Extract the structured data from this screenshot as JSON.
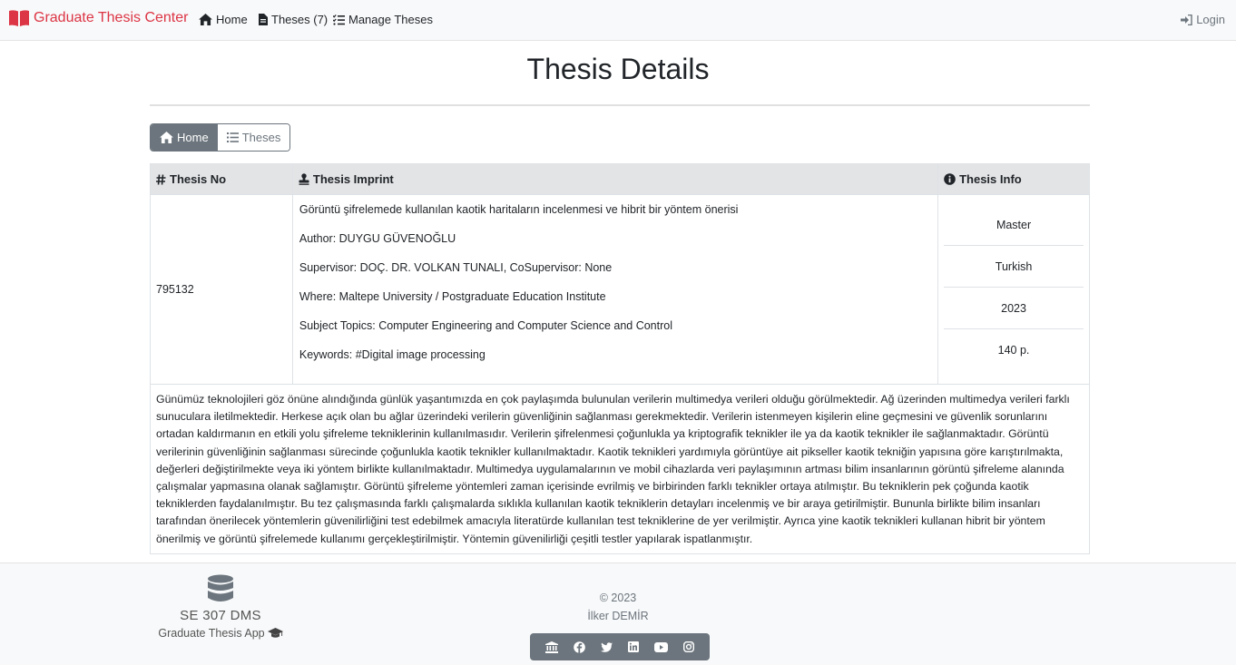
{
  "nav": {
    "brand": "Graduate Thesis Center",
    "home": "Home",
    "theses": "Theses (7)",
    "manage": "Manage Theses",
    "login": "Login"
  },
  "page_title": "Thesis Details",
  "buttons": {
    "home": "Home",
    "theses": "Theses"
  },
  "table": {
    "headers": {
      "no": "Thesis No",
      "imprint": "Thesis Imprint",
      "info": "Thesis Info"
    },
    "thesis_no": "795132",
    "imprint": {
      "title": "Görüntü şifrelemede kullanılan kaotik haritaların incelenmesi ve hibrit bir yöntem önerisi",
      "author": "Author: DUYGU GÜVENOĞLU",
      "supervisor": "Supervisor: DOÇ. DR. VOLKAN TUNALI, CoSupervisor: None",
      "where": "Where: Maltepe University / Postgraduate Education Institute",
      "subjects": "Subject Topics: Computer Engineering and Computer Science and Control",
      "keywords": "Keywords: #Digital image processing"
    },
    "info": {
      "type": "Master",
      "language": "Turkish",
      "year": "2023",
      "pages": "140 p."
    },
    "abstract": "Günümüz teknolojileri göz önüne alındığında günlük yaşantımızda en çok paylaşımda bulunulan verilerin multimedya verileri olduğu görülmektedir. Ağ üzerinden multimedya verileri farklı sunuculara iletilmektedir. Herkese açık olan bu ağlar üzerindeki verilerin güvenliğinin sağlanması gerekmektedir. Verilerin istenmeyen kişilerin eline geçmesini ve güvenlik sorunlarını ortadan kaldırmanın en etkili yolu şifreleme tekniklerinin kullanılmasıdır. Verilerin şifrelenmesi çoğunlukla ya kriptografik teknikler ile ya da kaotik teknikler ile sağlanmaktadır. Görüntü verilerinin güvenliğinin sağlanması sürecinde çoğunlukla kaotik teknikler kullanılmaktadır. Kaotik teknikleri yardımıyla görüntüye ait pikseller kaotik tekniğin yapısına göre karıştırılmakta, değerleri değiştirilmekte veya iki yöntem birlikte kullanılmaktadır. Multimedya uygulamalarının ve mobil cihazlarda veri paylaşımının artması bilim insanlarının görüntü şifreleme alanında çalışmalar yapmasına olanak sağlamıştır. Görüntü şifreleme yöntemleri zaman içerisinde evrilmiş ve birbirinden farklı teknikler ortaya atılmıştır. Bu tekniklerin pek çoğunda kaotik tekniklerden faydalanılmıştır. Bu tez çalışmasında farklı çalışmalarda sıklıkla kullanılan kaotik tekniklerin detayları incelenmiş ve bir araya getirilmiştir. Bununla birlikte bilim insanları tarafından önerilecek yöntemlerin güvenilirliğini test edebilmek amacıyla literatürde kullanılan test tekniklerine de yer verilmiştir. Ayrıca yine kaotik teknikleri kullanan hibrit bir yöntem önerilmiş ve görüntü şifrelemede kullanımı gerçekleştirilmiştir. Yöntemin güvenilirliği çeşitli testler yapılarak ispatlanmıştır."
  },
  "footer": {
    "name": "SE 307 DMS",
    "app": "Graduate Thesis App",
    "copyright": "© 2023",
    "author": "İlker DEMİR",
    "social_icons": [
      "university-icon",
      "facebook-icon",
      "twitter-icon",
      "linkedin-icon",
      "youtube-icon",
      "instagram-icon"
    ]
  },
  "colors": {
    "brand": "#dc3545",
    "secondary": "#6c757d",
    "header_bg": "#e3e4e6"
  }
}
